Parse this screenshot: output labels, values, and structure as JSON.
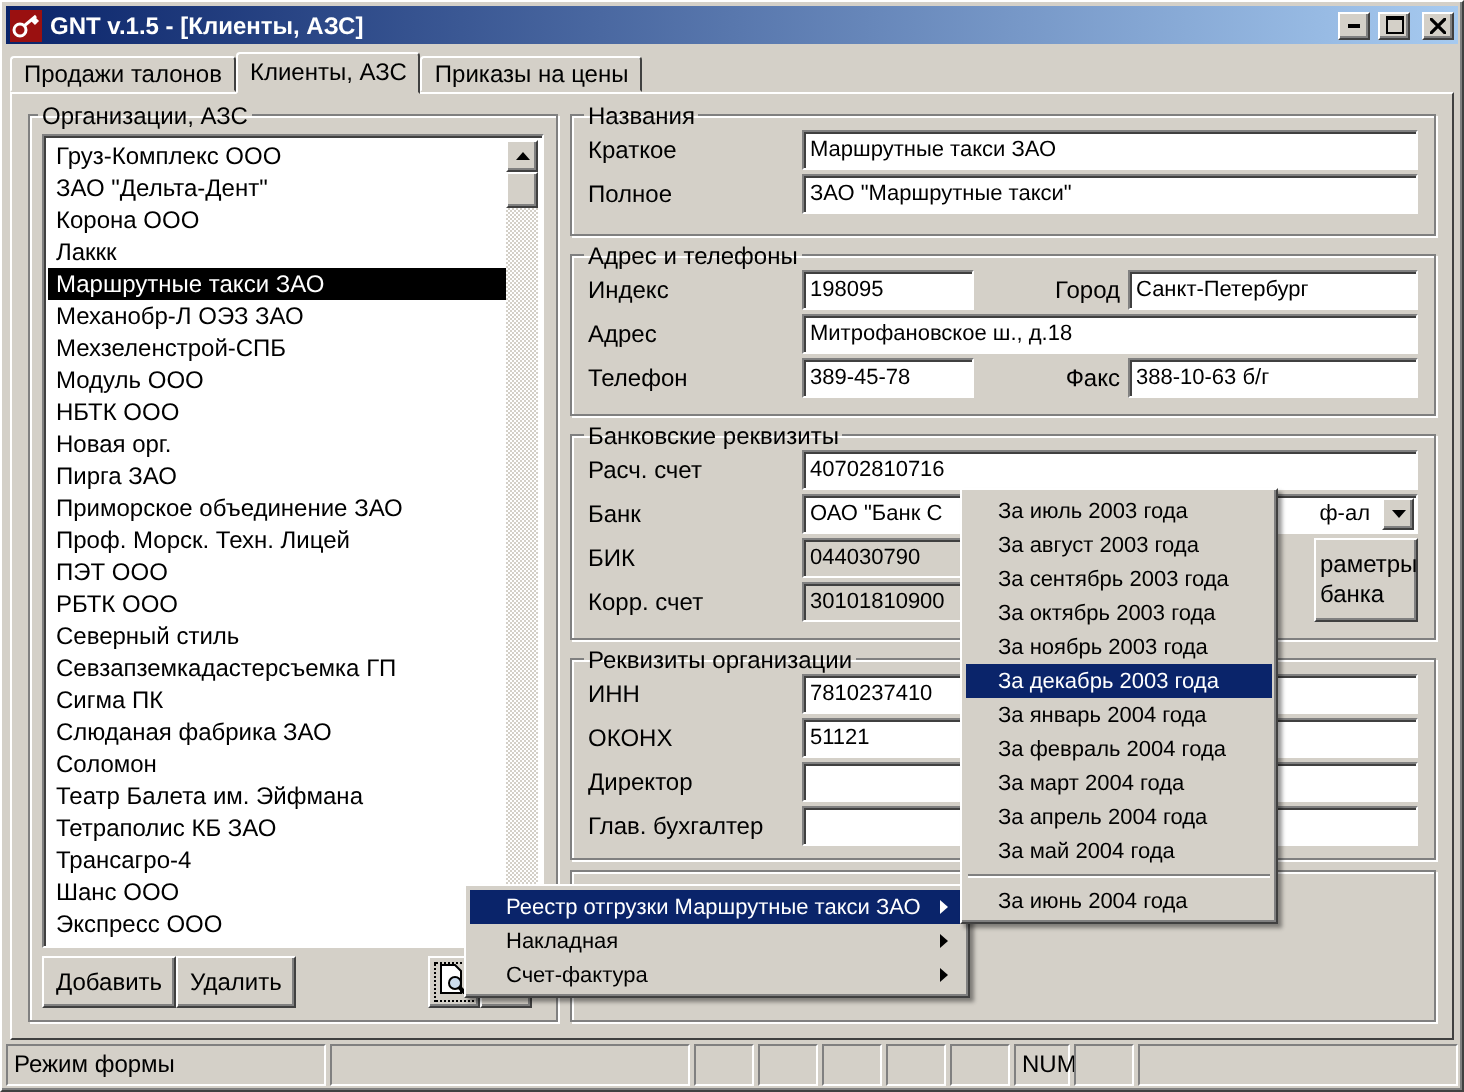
{
  "window": {
    "title": "GNT v.1.5 - [Клиенты, АЗС]"
  },
  "tabs": [
    {
      "label": "Продажи талонов",
      "selected": false
    },
    {
      "label": "Клиенты, АЗС",
      "selected": true
    },
    {
      "label": "Приказы на цены",
      "selected": false
    }
  ],
  "organizations": {
    "title": "Организации, АЗС",
    "items": [
      {
        "label": "Груз-Комплекс ООО",
        "selected": false
      },
      {
        "label": "ЗАО \"Дельта-Дент\"",
        "selected": false
      },
      {
        "label": "Корона ООО",
        "selected": false
      },
      {
        "label": "Лаккк",
        "selected": false
      },
      {
        "label": "Маршрутные такси ЗАО",
        "selected": true
      },
      {
        "label": "Механобр-Л ОЭЗ ЗАО",
        "selected": false
      },
      {
        "label": "Мехзеленстрой-СПБ",
        "selected": false
      },
      {
        "label": "Модуль ООО",
        "selected": false
      },
      {
        "label": "НБТК ООО",
        "selected": false
      },
      {
        "label": "Новая орг.",
        "selected": false
      },
      {
        "label": "Пирга ЗАО",
        "selected": false
      },
      {
        "label": "Приморское объединение ЗАО",
        "selected": false
      },
      {
        "label": "Проф. Морск. Техн. Лицей",
        "selected": false
      },
      {
        "label": "ПЭТ ООО",
        "selected": false
      },
      {
        "label": "РБТК ООО",
        "selected": false
      },
      {
        "label": "Северный стиль",
        "selected": false
      },
      {
        "label": "Севзапземкадастерсъемка ГП",
        "selected": false
      },
      {
        "label": "Сигма ПК",
        "selected": false
      },
      {
        "label": "Слюданая фабрика ЗАО",
        "selected": false
      },
      {
        "label": "Соломон",
        "selected": false
      },
      {
        "label": "Театр Балета им. Эйфмана",
        "selected": false
      },
      {
        "label": "Тетраполис КБ ЗАО",
        "selected": false
      },
      {
        "label": "Трансагро-4",
        "selected": false
      },
      {
        "label": "Шанс ООО",
        "selected": false
      },
      {
        "label": "Экспресс ООО",
        "selected": false
      }
    ],
    "buttons": [
      "Добавить",
      "Удалить"
    ]
  },
  "names": {
    "title": "Названия",
    "short_label": "Краткое",
    "short_value": "Маршрутные такси ЗАО",
    "full_label": "Полное",
    "full_value": "ЗАО \"Маршрутные такси\""
  },
  "address": {
    "title": "Адрес и телефоны",
    "index_label": "Индекс",
    "index_value": "198095",
    "city_label": "Город",
    "city_value": "Санкт-Петербург",
    "address_label": "Адрес",
    "address_value": "Митрофановское ш., д.18",
    "phone_label": "Телефон",
    "phone_value": "389-45-78",
    "fax_label": "Факс",
    "fax_value": "388-10-63 б/г"
  },
  "bank": {
    "title": "Банковские реквизиты",
    "account_label": "Расч. счет",
    "account_value": "40702810716",
    "bank_label": "Банк",
    "bank_value": "ОАО \"Банк С",
    "bank_value_tail": "ф-ал",
    "bik_label": "БИК",
    "bik_value": "044030790",
    "corr_label": "Корр. счет",
    "corr_value": "30101810900",
    "params_button": [
      "раметры",
      "банка"
    ]
  },
  "org_details": {
    "title": "Реквизиты организации",
    "inn_label": "ИНН",
    "inn_value": "7810237410",
    "okonh_label": "ОКОНХ",
    "okonh_value": "51121",
    "director_label": "Директор",
    "accountant_label": "Глав. бухгалтер"
  },
  "context_menu": [
    {
      "label": "Реестр отгрузки Маршрутные такси ЗАО",
      "selected": true
    },
    {
      "label": "Накладная",
      "selected": false
    },
    {
      "label": "Счет-фактура",
      "selected": false
    }
  ],
  "submenu": [
    {
      "label": "За июль 2003 года",
      "selected": false
    },
    {
      "label": "За август 2003 года",
      "selected": false
    },
    {
      "label": "За сентябрь 2003 года",
      "selected": false
    },
    {
      "label": "За октябрь 2003 года",
      "selected": false
    },
    {
      "label": "За ноябрь 2003 года",
      "selected": false
    },
    {
      "label": "За декабрь 2003 года",
      "selected": true
    },
    {
      "label": "За январь 2004 года",
      "selected": false
    },
    {
      "label": "За февраль 2004 года",
      "selected": false
    },
    {
      "label": "За март 2004 года",
      "selected": false
    },
    {
      "label": "За апрель 2004 года",
      "selected": false
    },
    {
      "label": "За май 2004 года",
      "selected": false
    },
    {
      "label": "За июнь 2004 года",
      "selected": false,
      "separator_before": true
    }
  ],
  "status_bar": {
    "mode": "Режим формы",
    "num": "NUM"
  }
}
